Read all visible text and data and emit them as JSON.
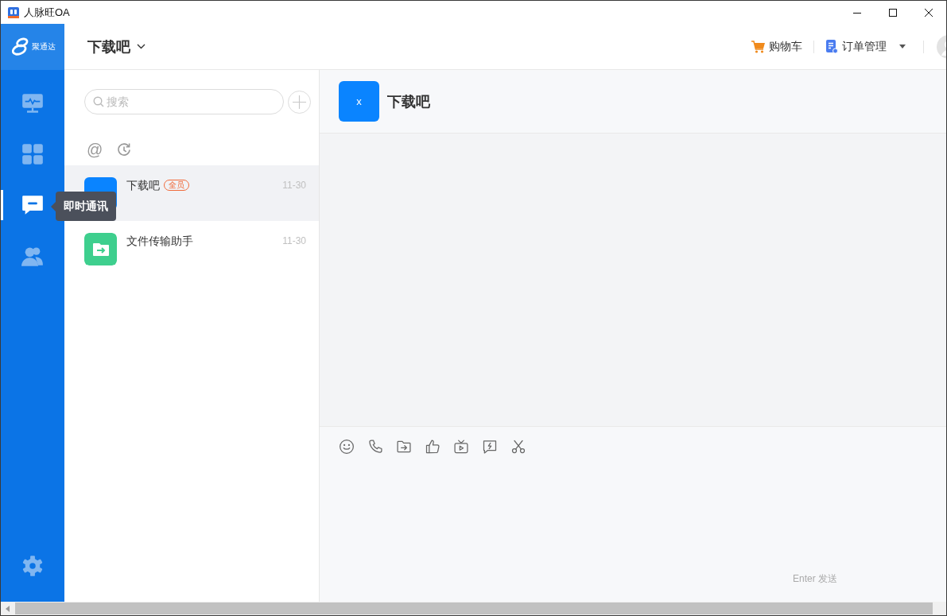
{
  "window": {
    "title": "人脉旺OA"
  },
  "logo": {
    "text": "聚通达"
  },
  "sidebar": {
    "items": [
      {
        "kind": "monitor",
        "selected": false
      },
      {
        "kind": "apps",
        "selected": false
      },
      {
        "kind": "chat",
        "selected": true,
        "tooltip": "即时通讯"
      },
      {
        "kind": "contacts",
        "selected": false
      }
    ],
    "footer": {
      "kind": "settings"
    }
  },
  "header": {
    "title": "下载吧",
    "actions": [
      {
        "kind": "cart",
        "label": "购物车",
        "has_menu": false
      },
      {
        "kind": "orders",
        "label": "订单管理",
        "has_menu": true
      }
    ]
  },
  "search": {
    "placeholder": "搜索"
  },
  "filters": {
    "mention_symbol": "@"
  },
  "conversations": [
    {
      "name": "下载吧",
      "tag": "全员",
      "time": "11-30",
      "selected": true,
      "avatar": {
        "kind": "group",
        "color": "#0a84ff"
      }
    },
    {
      "name": "文件传输助手",
      "time": "11-30",
      "selected": false,
      "avatar": {
        "kind": "file_transfer",
        "color": "#3ecf8e"
      }
    }
  ],
  "chat": {
    "title": "下载吧",
    "avatar_text": "x",
    "send_hint": "Enter 发送"
  }
}
